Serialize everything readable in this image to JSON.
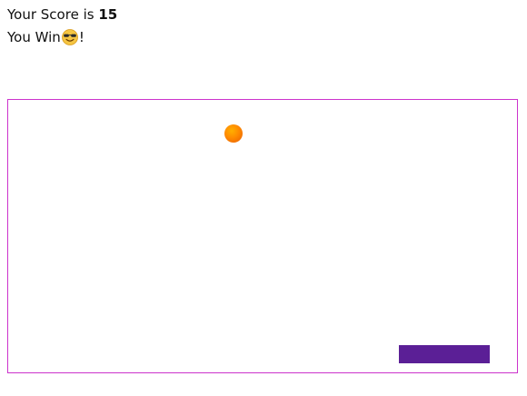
{
  "score": {
    "prefix": "Your Score is ",
    "value": "15"
  },
  "result": {
    "text": "You Win",
    "suffix": "!",
    "emoji": "smiling-face-with-sunglasses-icon"
  },
  "colors": {
    "board_border": "#cc33cc",
    "paddle": "#5b1f96",
    "ball": "#ff8a00"
  }
}
